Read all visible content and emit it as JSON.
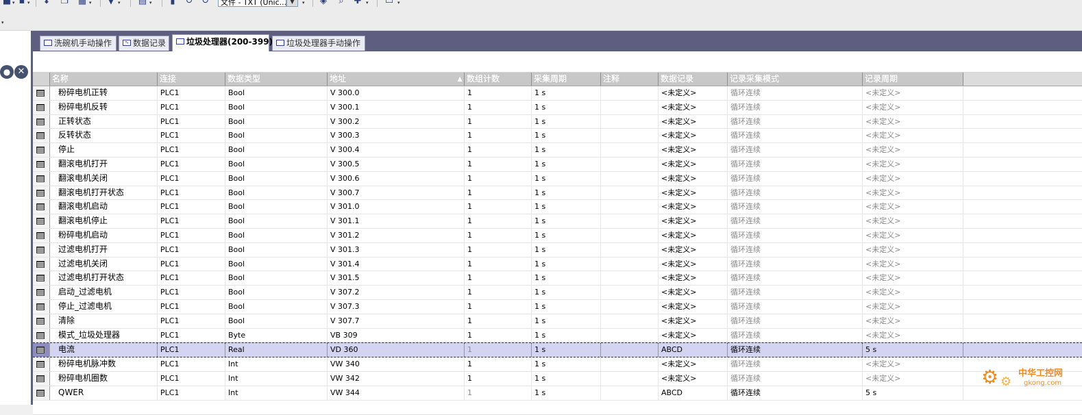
{
  "toolbar": {
    "combo_value": "文件 - TXT (Unic...",
    "icons": [
      "new-icon",
      "save-icon",
      "cut-icon",
      "copy-icon",
      "paste-icon",
      "undo-icon",
      "redo-icon",
      "download-icon",
      "grid-icon",
      "table-icon",
      "stop-icon",
      "refresh-icon",
      "run-icon",
      "find-icon",
      "layers-icon",
      "plugin-icon",
      "window-icon"
    ]
  },
  "tabs": [
    {
      "label": "洗碗机手动操作",
      "active": false
    },
    {
      "label": "数据记录",
      "active": false
    },
    {
      "label": "垃圾处理器(200-399)",
      "active": true
    },
    {
      "label": "垃圾处理器手动操作",
      "active": false
    }
  ],
  "table": {
    "columns": [
      "名称",
      "连接",
      "数据类型",
      "地址",
      "数组计数",
      "采集周期",
      "注释",
      "数据记录",
      "记录采集模式",
      "记录周期"
    ],
    "rows": [
      {
        "name": "粉碎电机正转",
        "conn": "PLC1",
        "type": "Bool",
        "addr": "V 300.0",
        "count": "1",
        "cycle": "1 s",
        "comment": "",
        "log": "<未定义>",
        "mode": "循环连续",
        "period": "<未定义>"
      },
      {
        "name": "粉碎电机反转",
        "conn": "PLC1",
        "type": "Bool",
        "addr": "V 300.1",
        "count": "1",
        "cycle": "1 s",
        "comment": "",
        "log": "<未定义>",
        "mode": "循环连续",
        "period": "<未定义>"
      },
      {
        "name": "正转状态",
        "conn": "PLC1",
        "type": "Bool",
        "addr": "V 300.2",
        "count": "1",
        "cycle": "1 s",
        "comment": "",
        "log": "<未定义>",
        "mode": "循环连续",
        "period": "<未定义>"
      },
      {
        "name": "反转状态",
        "conn": "PLC1",
        "type": "Bool",
        "addr": "V 300.3",
        "count": "1",
        "cycle": "1 s",
        "comment": "",
        "log": "<未定义>",
        "mode": "循环连续",
        "period": "<未定义>"
      },
      {
        "name": "停止",
        "conn": "PLC1",
        "type": "Bool",
        "addr": "V 300.4",
        "count": "1",
        "cycle": "1 s",
        "comment": "",
        "log": "<未定义>",
        "mode": "循环连续",
        "period": "<未定义>"
      },
      {
        "name": "翻滚电机打开",
        "conn": "PLC1",
        "type": "Bool",
        "addr": "V 300.5",
        "count": "1",
        "cycle": "1 s",
        "comment": "",
        "log": "<未定义>",
        "mode": "循环连续",
        "period": "<未定义>"
      },
      {
        "name": "翻滚电机关闭",
        "conn": "PLC1",
        "type": "Bool",
        "addr": "V 300.6",
        "count": "1",
        "cycle": "1 s",
        "comment": "",
        "log": "<未定义>",
        "mode": "循环连续",
        "period": "<未定义>"
      },
      {
        "name": "翻滚电机打开状态",
        "conn": "PLC1",
        "type": "Bool",
        "addr": "V 300.7",
        "count": "1",
        "cycle": "1 s",
        "comment": "",
        "log": "<未定义>",
        "mode": "循环连续",
        "period": "<未定义>"
      },
      {
        "name": "翻滚电机启动",
        "conn": "PLC1",
        "type": "Bool",
        "addr": "V 301.0",
        "count": "1",
        "cycle": "1 s",
        "comment": "",
        "log": "<未定义>",
        "mode": "循环连续",
        "period": "<未定义>"
      },
      {
        "name": "翻滚电机停止",
        "conn": "PLC1",
        "type": "Bool",
        "addr": "V 301.1",
        "count": "1",
        "cycle": "1 s",
        "comment": "",
        "log": "<未定义>",
        "mode": "循环连续",
        "period": "<未定义>"
      },
      {
        "name": "粉碎电机启动",
        "conn": "PLC1",
        "type": "Bool",
        "addr": "V 301.2",
        "count": "1",
        "cycle": "1 s",
        "comment": "",
        "log": "<未定义>",
        "mode": "循环连续",
        "period": "<未定义>"
      },
      {
        "name": "过滤电机打开",
        "conn": "PLC1",
        "type": "Bool",
        "addr": "V 301.3",
        "count": "1",
        "cycle": "1 s",
        "comment": "",
        "log": "<未定义>",
        "mode": "循环连续",
        "period": "<未定义>"
      },
      {
        "name": "过滤电机关闭",
        "conn": "PLC1",
        "type": "Bool",
        "addr": "V 301.4",
        "count": "1",
        "cycle": "1 s",
        "comment": "",
        "log": "<未定义>",
        "mode": "循环连续",
        "period": "<未定义>"
      },
      {
        "name": "过滤电机打开状态",
        "conn": "PLC1",
        "type": "Bool",
        "addr": "V 301.5",
        "count": "1",
        "cycle": "1 s",
        "comment": "",
        "log": "<未定义>",
        "mode": "循环连续",
        "period": "<未定义>"
      },
      {
        "name": "启动_过滤电机",
        "conn": "PLC1",
        "type": "Bool",
        "addr": "V 307.2",
        "count": "1",
        "cycle": "1 s",
        "comment": "",
        "log": "<未定义>",
        "mode": "循环连续",
        "period": "<未定义>"
      },
      {
        "name": "停止_过滤电机",
        "conn": "PLC1",
        "type": "Bool",
        "addr": "V 307.3",
        "count": "1",
        "cycle": "1 s",
        "comment": "",
        "log": "<未定义>",
        "mode": "循环连续",
        "period": "<未定义>"
      },
      {
        "name": "清除",
        "conn": "PLC1",
        "type": "Bool",
        "addr": "V 307.7",
        "count": "1",
        "cycle": "1 s",
        "comment": "",
        "log": "<未定义>",
        "mode": "循环连续",
        "period": "<未定义>"
      },
      {
        "name": "模式_垃圾处理器",
        "conn": "PLC1",
        "type": "Byte",
        "addr": "VB 309",
        "count": "1",
        "cycle": "1 s",
        "comment": "",
        "log": "<未定义>",
        "mode": "循环连续",
        "period": "<未定义>"
      },
      {
        "name": "电流",
        "conn": "PLC1",
        "type": "Real",
        "addr": "VD 360",
        "count": "1",
        "cycle": "1 s",
        "comment": "",
        "log": "ABCD",
        "mode": "循环连续",
        "period": "5 s",
        "selected": true
      },
      {
        "name": "粉碎电机脉冲数",
        "conn": "PLC1",
        "type": "Int",
        "addr": "VW 340",
        "count": "1",
        "cycle": "1 s",
        "comment": "",
        "log": "<未定义>",
        "mode": "循环连续",
        "period": "<未定义>"
      },
      {
        "name": "粉碎电机圈数",
        "conn": "PLC1",
        "type": "Int",
        "addr": "VW 342",
        "count": "1",
        "cycle": "1 s",
        "comment": "",
        "log": "<未定义>",
        "mode": "循环连续",
        "period": "<未定义>"
      },
      {
        "name": "QWER",
        "conn": "PLC1",
        "type": "Int",
        "addr": "VW 344",
        "count": "1",
        "cycle": "1 s",
        "comment": "",
        "log": "ABCD",
        "mode": "循环连续",
        "period": "5 s"
      }
    ]
  },
  "watermark": {
    "title": "中华工控网",
    "sub": "gkong.com"
  },
  "colors": {
    "tab_bar": "#5e5e80",
    "selected_row": "#d3d3f2",
    "header": "#c8c8c8",
    "watermark": "#f08a1c"
  }
}
